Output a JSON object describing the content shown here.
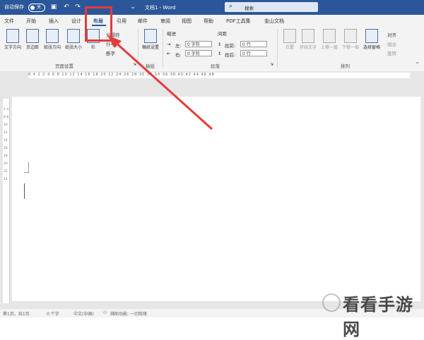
{
  "titlebar": {
    "autosave_label": "自动保存",
    "toggle_state": "关",
    "doc_title": "文档1 - Word",
    "search_placeholder": "搜索"
  },
  "tabs": [
    {
      "label": "文件"
    },
    {
      "label": "开始"
    },
    {
      "label": "插入"
    },
    {
      "label": "设计"
    },
    {
      "label": "布局",
      "active": true
    },
    {
      "label": "引用"
    },
    {
      "label": "邮件"
    },
    {
      "label": "审阅"
    },
    {
      "label": "视图"
    },
    {
      "label": "帮助"
    },
    {
      "label": "PDF工具集"
    },
    {
      "label": "金山文档"
    }
  ],
  "ribbon": {
    "page_setup": {
      "buttons": [
        "文字方向",
        "页边距",
        "纸张方向",
        "纸张大小",
        "栏"
      ],
      "small": [
        "分隔符",
        "行号",
        "断字"
      ],
      "group_label": "页面设置"
    },
    "draft": {
      "button": "稿纸设置",
      "group_label": "稿纸"
    },
    "paragraph": {
      "indent_label": "缩进",
      "spacing_label": "间距",
      "left_label": "左:",
      "right_label": "右:",
      "before_label": "段前:",
      "after_label": "段后:",
      "left_value": "0 字符",
      "right_value": "0 字符",
      "before_value": "0 行",
      "after_value": "0 行",
      "group_label": "段落"
    },
    "arrange": {
      "buttons": [
        "位置",
        "环绕文字",
        "上移一层",
        "下移一层",
        "选择窗格"
      ],
      "small": [
        "对齐",
        "组合",
        "旋转"
      ],
      "group_label": "排列"
    }
  },
  "ruler": {
    "numbers": "6 4 2 2 4 6 8 10 12 14 16 18 20 22 24 26 28 30 32 34 36 38 40 42 44 46 48"
  },
  "vruler": {
    "numbers": "2 4 6 8 10 12 14 16 18 20 22 24"
  },
  "status": {
    "page": "第1页，共1页",
    "words": "0 个字",
    "language": "中文(中国)",
    "accessibility": "辅助功能: 一切就绪"
  },
  "watermark": {
    "text": "看看手游网"
  },
  "colors": {
    "accent": "#2b579a",
    "highlight": "#e33b3b"
  }
}
